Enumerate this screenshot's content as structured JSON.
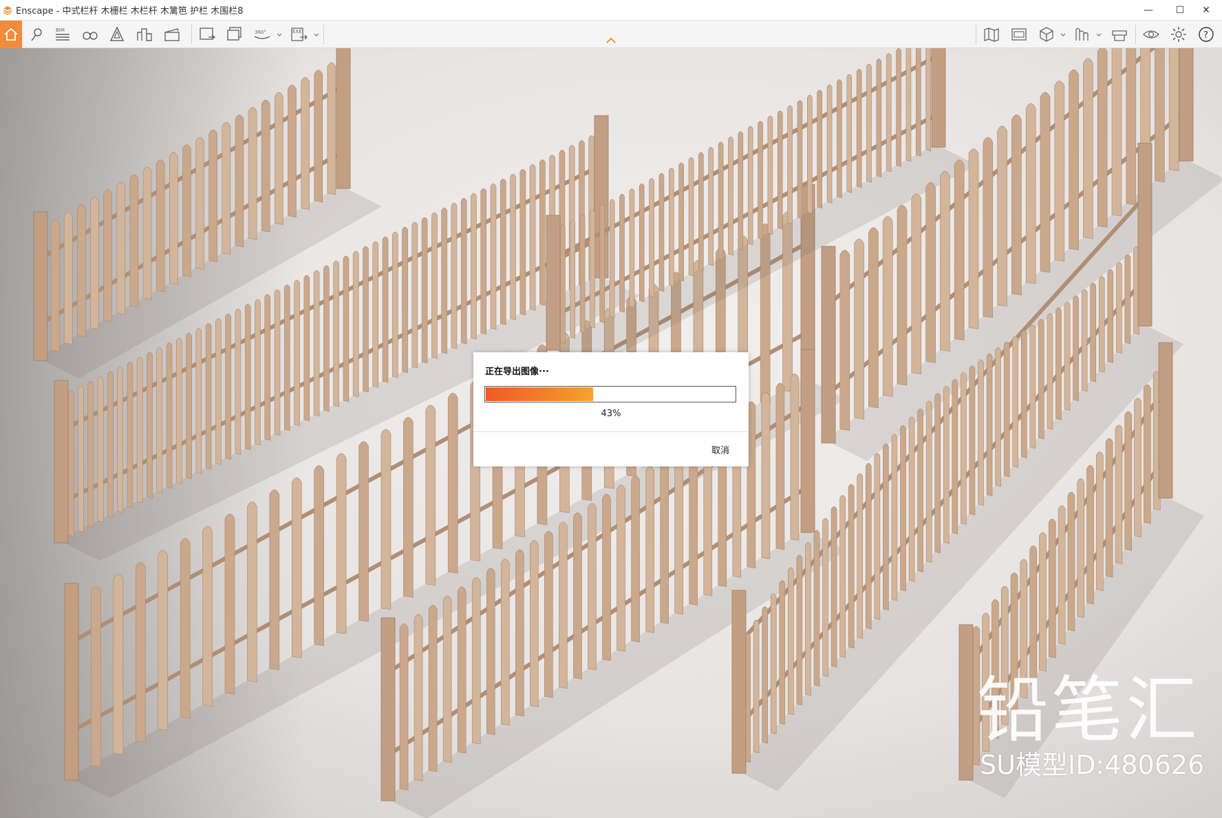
{
  "window": {
    "title": "Enscape - 中式栏杆 木栅栏 木栏杆 木篱笆 护栏 木围栏8",
    "controls": {
      "minimize": "—",
      "maximize": "☐",
      "close": "✕"
    }
  },
  "toolbar": {
    "left_buttons": [
      {
        "icon": "home-icon"
      },
      {
        "icon": "location-pin-icon"
      },
      {
        "icon": "bim-icon",
        "text": "BIM"
      },
      {
        "icon": "binoculars-icon"
      },
      {
        "icon": "material-editor-icon"
      },
      {
        "icon": "asset-library-icon"
      },
      {
        "icon": "video-editor-icon"
      },
      {
        "icon": "screenshot-icon"
      },
      {
        "icon": "batch-render-icon"
      },
      {
        "icon": "panorama-360-icon",
        "text": "360°"
      },
      {
        "icon": "export-exe-icon",
        "text": "EXE"
      }
    ],
    "right_buttons": [
      {
        "icon": "map-icon"
      },
      {
        "icon": "views-icon"
      },
      {
        "icon": "cube-icon"
      },
      {
        "icon": "ruler-icon"
      },
      {
        "icon": "collaboration-icon"
      },
      {
        "icon": "visibility-icon"
      },
      {
        "icon": "settings-gear-icon"
      },
      {
        "icon": "help-icon",
        "text": "?"
      }
    ]
  },
  "dialog": {
    "title": "正在导出图像···",
    "progress": 43,
    "progress_label": "43%",
    "cancel_label": "取消"
  },
  "watermark": {
    "logo_text": "铅笔汇",
    "model_id": "SU模型ID:480626"
  },
  "colors": {
    "accent": "#f28b3c",
    "progress_start": "#f15a24",
    "progress_end": "#f6a32e",
    "wood": "#caa88c"
  }
}
